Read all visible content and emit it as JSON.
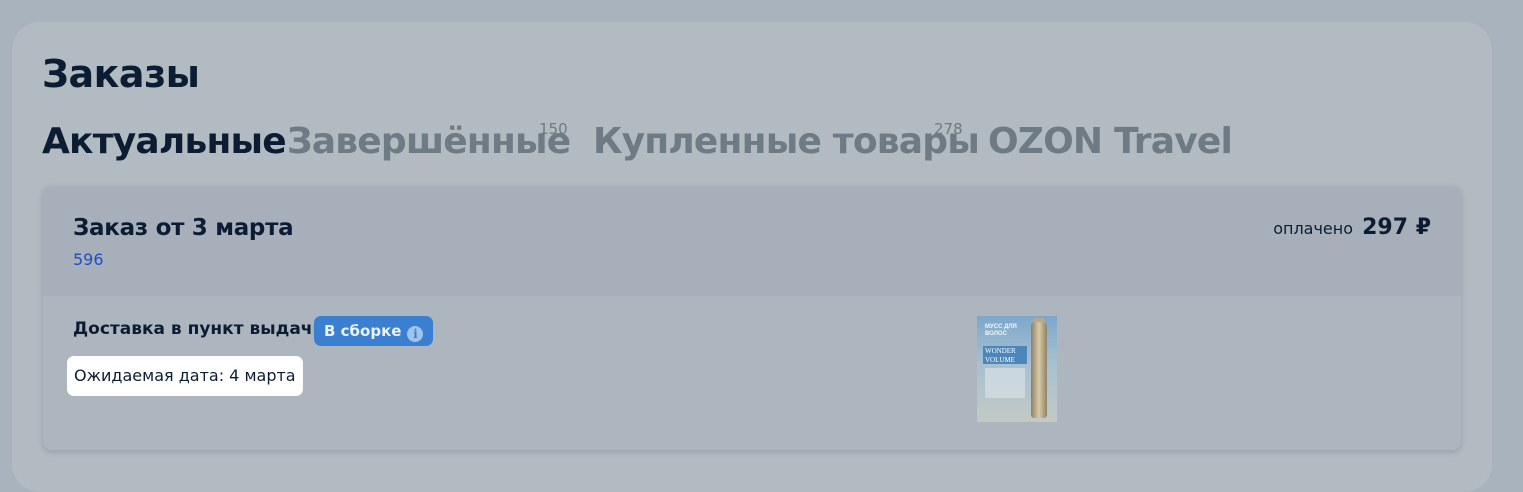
{
  "page": {
    "title": "Заказы"
  },
  "tabs": [
    {
      "label": "Актуальные",
      "count": "",
      "active": true
    },
    {
      "label": "Завершённые",
      "count": "150",
      "active": false
    },
    {
      "label": "Купленные товары",
      "count": "278",
      "active": false
    },
    {
      "label": "OZON Travel",
      "count": "",
      "active": false
    }
  ],
  "order": {
    "title": "Заказ от 3 марта",
    "number": "596",
    "paid_label": "оплачено",
    "paid_amount": "297 ₽",
    "delivery_type": "Доставка в пункт выдачи",
    "status": "В сборке",
    "expected_date": "Ожидаемая дата: 4 марта",
    "product": {
      "icon": "hair-mousse-product-image",
      "package_text": "МУСС ДЛЯ ВОЛОС",
      "brand_text": "WONDER VOLUME"
    }
  },
  "colors": {
    "background": "#a8b3be",
    "text_dark": "#0c1d33",
    "tab_inactive": "#6e7a84",
    "link": "#1c4fc4",
    "badge": "#3a7fd0"
  }
}
